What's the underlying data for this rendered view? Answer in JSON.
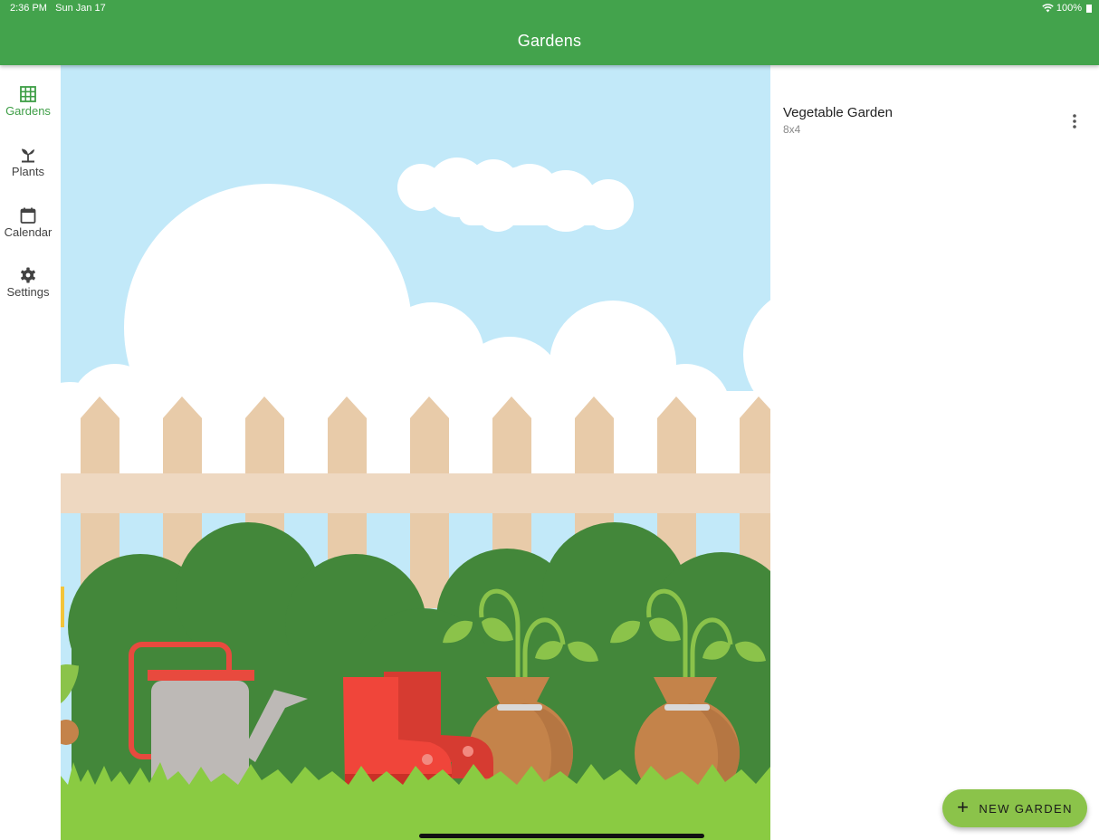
{
  "status_bar": {
    "time": "2:36 PM",
    "date": "Sun Jan 17",
    "battery": "100%"
  },
  "app_bar": {
    "title": "Gardens"
  },
  "nav": [
    {
      "label": "Gardens",
      "icon": "grid-icon",
      "active": true
    },
    {
      "label": "Plants",
      "icon": "sprout-icon",
      "active": false
    },
    {
      "label": "Calendar",
      "icon": "calendar-icon",
      "active": false
    },
    {
      "label": "Settings",
      "icon": "gear-icon",
      "active": false
    }
  ],
  "gardens": [
    {
      "name": "Vegetable Garden",
      "size": "8x4"
    }
  ],
  "fab": {
    "label": "NEW GARDEN",
    "icon": "plus-icon"
  },
  "colors": {
    "primary": "#43a34c",
    "accent": "#8bc34a",
    "sky": "#c2e9f9",
    "fence": "#e8cba9",
    "bush": "#43873a"
  }
}
